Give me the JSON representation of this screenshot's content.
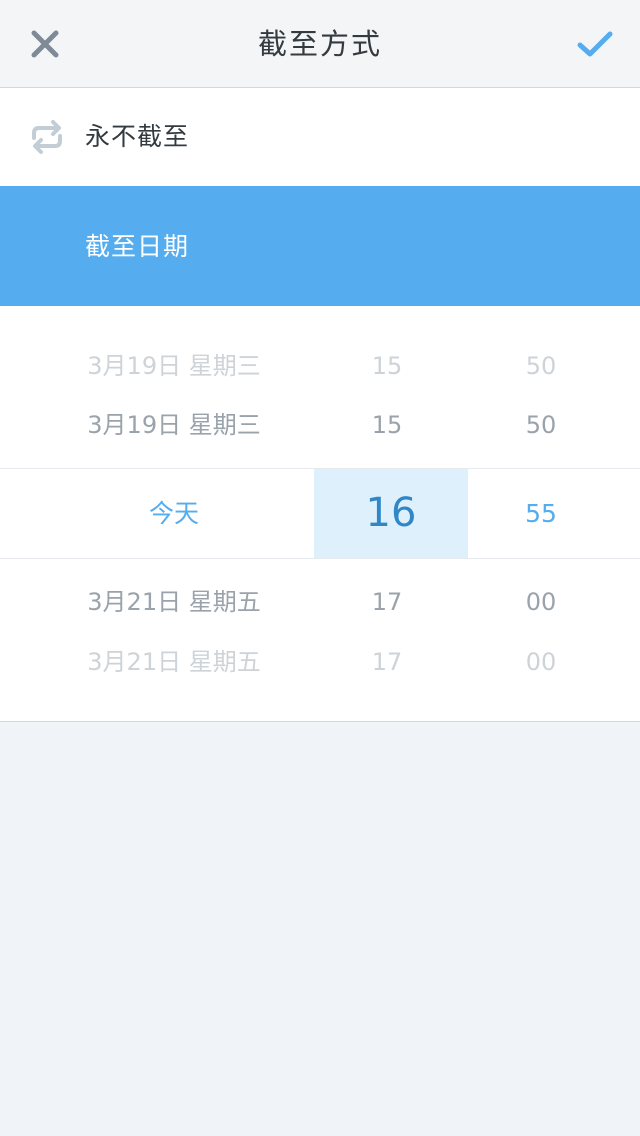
{
  "nav": {
    "title": "截至方式",
    "close_icon": "close-icon",
    "confirm_icon": "checkmark-icon"
  },
  "options": {
    "never_label": "永不截至",
    "never_icon": "repeat-icon",
    "date_label": "截至日期"
  },
  "picker": {
    "rows": [
      {
        "date": "3月19日 星期三",
        "hour": "15",
        "minute": "50"
      },
      {
        "date": "3月19日 星期三",
        "hour": "15",
        "minute": "50"
      },
      {
        "date": "3月21日 星期五",
        "hour": "17",
        "minute": "00"
      },
      {
        "date": "3月21日 星期五",
        "hour": "17",
        "minute": "00"
      }
    ],
    "selected": {
      "date": "今天",
      "hour": "16",
      "minute": "55"
    }
  },
  "colors": {
    "accent": "#55acee",
    "selected_hour_bg": "#dff0fd",
    "nav_bg": "#f4f5f7",
    "page_bg": "#f0f4f8"
  }
}
